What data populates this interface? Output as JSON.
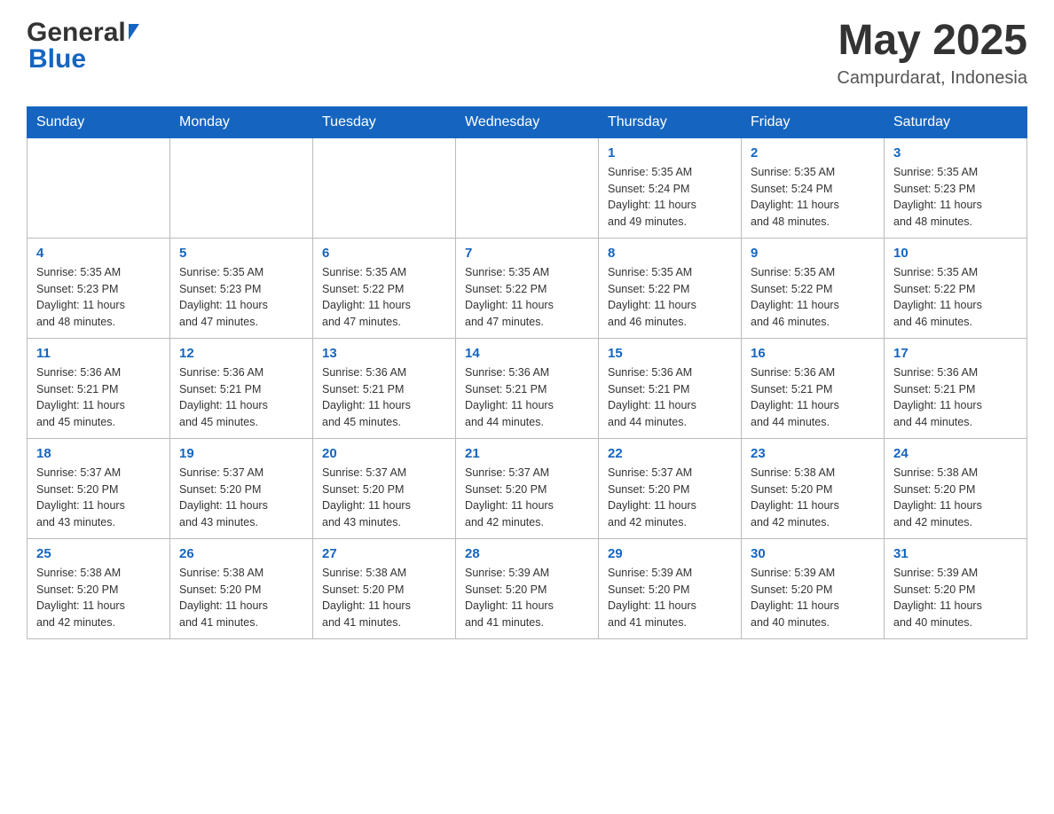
{
  "header": {
    "logo_general": "General",
    "logo_blue": "Blue",
    "month_year": "May 2025",
    "location": "Campurdarat, Indonesia"
  },
  "days_of_week": [
    "Sunday",
    "Monday",
    "Tuesday",
    "Wednesday",
    "Thursday",
    "Friday",
    "Saturday"
  ],
  "weeks": [
    [
      {
        "day": "",
        "info": ""
      },
      {
        "day": "",
        "info": ""
      },
      {
        "day": "",
        "info": ""
      },
      {
        "day": "",
        "info": ""
      },
      {
        "day": "1",
        "info": "Sunrise: 5:35 AM\nSunset: 5:24 PM\nDaylight: 11 hours\nand 49 minutes."
      },
      {
        "day": "2",
        "info": "Sunrise: 5:35 AM\nSunset: 5:24 PM\nDaylight: 11 hours\nand 48 minutes."
      },
      {
        "day": "3",
        "info": "Sunrise: 5:35 AM\nSunset: 5:23 PM\nDaylight: 11 hours\nand 48 minutes."
      }
    ],
    [
      {
        "day": "4",
        "info": "Sunrise: 5:35 AM\nSunset: 5:23 PM\nDaylight: 11 hours\nand 48 minutes."
      },
      {
        "day": "5",
        "info": "Sunrise: 5:35 AM\nSunset: 5:23 PM\nDaylight: 11 hours\nand 47 minutes."
      },
      {
        "day": "6",
        "info": "Sunrise: 5:35 AM\nSunset: 5:22 PM\nDaylight: 11 hours\nand 47 minutes."
      },
      {
        "day": "7",
        "info": "Sunrise: 5:35 AM\nSunset: 5:22 PM\nDaylight: 11 hours\nand 47 minutes."
      },
      {
        "day": "8",
        "info": "Sunrise: 5:35 AM\nSunset: 5:22 PM\nDaylight: 11 hours\nand 46 minutes."
      },
      {
        "day": "9",
        "info": "Sunrise: 5:35 AM\nSunset: 5:22 PM\nDaylight: 11 hours\nand 46 minutes."
      },
      {
        "day": "10",
        "info": "Sunrise: 5:35 AM\nSunset: 5:22 PM\nDaylight: 11 hours\nand 46 minutes."
      }
    ],
    [
      {
        "day": "11",
        "info": "Sunrise: 5:36 AM\nSunset: 5:21 PM\nDaylight: 11 hours\nand 45 minutes."
      },
      {
        "day": "12",
        "info": "Sunrise: 5:36 AM\nSunset: 5:21 PM\nDaylight: 11 hours\nand 45 minutes."
      },
      {
        "day": "13",
        "info": "Sunrise: 5:36 AM\nSunset: 5:21 PM\nDaylight: 11 hours\nand 45 minutes."
      },
      {
        "day": "14",
        "info": "Sunrise: 5:36 AM\nSunset: 5:21 PM\nDaylight: 11 hours\nand 44 minutes."
      },
      {
        "day": "15",
        "info": "Sunrise: 5:36 AM\nSunset: 5:21 PM\nDaylight: 11 hours\nand 44 minutes."
      },
      {
        "day": "16",
        "info": "Sunrise: 5:36 AM\nSunset: 5:21 PM\nDaylight: 11 hours\nand 44 minutes."
      },
      {
        "day": "17",
        "info": "Sunrise: 5:36 AM\nSunset: 5:21 PM\nDaylight: 11 hours\nand 44 minutes."
      }
    ],
    [
      {
        "day": "18",
        "info": "Sunrise: 5:37 AM\nSunset: 5:20 PM\nDaylight: 11 hours\nand 43 minutes."
      },
      {
        "day": "19",
        "info": "Sunrise: 5:37 AM\nSunset: 5:20 PM\nDaylight: 11 hours\nand 43 minutes."
      },
      {
        "day": "20",
        "info": "Sunrise: 5:37 AM\nSunset: 5:20 PM\nDaylight: 11 hours\nand 43 minutes."
      },
      {
        "day": "21",
        "info": "Sunrise: 5:37 AM\nSunset: 5:20 PM\nDaylight: 11 hours\nand 42 minutes."
      },
      {
        "day": "22",
        "info": "Sunrise: 5:37 AM\nSunset: 5:20 PM\nDaylight: 11 hours\nand 42 minutes."
      },
      {
        "day": "23",
        "info": "Sunrise: 5:38 AM\nSunset: 5:20 PM\nDaylight: 11 hours\nand 42 minutes."
      },
      {
        "day": "24",
        "info": "Sunrise: 5:38 AM\nSunset: 5:20 PM\nDaylight: 11 hours\nand 42 minutes."
      }
    ],
    [
      {
        "day": "25",
        "info": "Sunrise: 5:38 AM\nSunset: 5:20 PM\nDaylight: 11 hours\nand 42 minutes."
      },
      {
        "day": "26",
        "info": "Sunrise: 5:38 AM\nSunset: 5:20 PM\nDaylight: 11 hours\nand 41 minutes."
      },
      {
        "day": "27",
        "info": "Sunrise: 5:38 AM\nSunset: 5:20 PM\nDaylight: 11 hours\nand 41 minutes."
      },
      {
        "day": "28",
        "info": "Sunrise: 5:39 AM\nSunset: 5:20 PM\nDaylight: 11 hours\nand 41 minutes."
      },
      {
        "day": "29",
        "info": "Sunrise: 5:39 AM\nSunset: 5:20 PM\nDaylight: 11 hours\nand 41 minutes."
      },
      {
        "day": "30",
        "info": "Sunrise: 5:39 AM\nSunset: 5:20 PM\nDaylight: 11 hours\nand 40 minutes."
      },
      {
        "day": "31",
        "info": "Sunrise: 5:39 AM\nSunset: 5:20 PM\nDaylight: 11 hours\nand 40 minutes."
      }
    ]
  ]
}
